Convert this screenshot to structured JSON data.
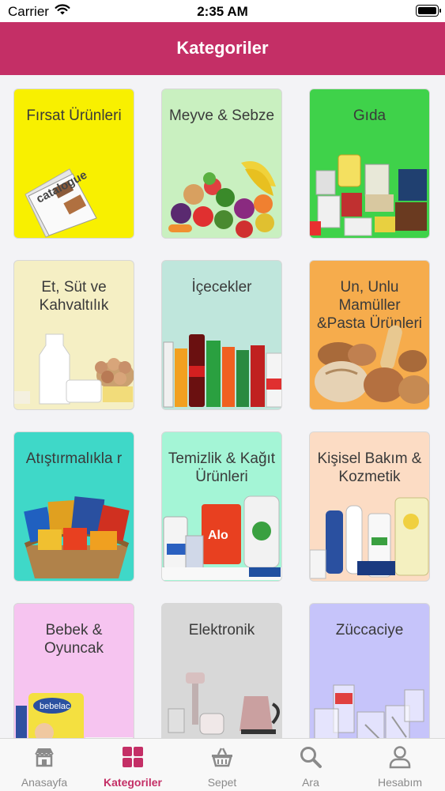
{
  "status": {
    "carrier": "Carrier",
    "time": "2:35 AM"
  },
  "header": {
    "title": "Kategoriler"
  },
  "categories": [
    {
      "label": "Fırsat Ürünleri",
      "bg": "#f8f000",
      "icon": "catalogue-image"
    },
    {
      "label": "Meyve & Sebze",
      "bg": "#c9f0c0",
      "icon": "fruits-vegetables-image"
    },
    {
      "label": "Gıda",
      "bg": "#3fd24a",
      "icon": "grocery-products-image"
    },
    {
      "label": "Et, Süt ve Kahvaltılık",
      "bg": "#f5efc4",
      "icon": "dairy-breakfast-image"
    },
    {
      "label": "İçecekler",
      "bg": "#bfe6dc",
      "icon": "beverages-image"
    },
    {
      "label": "Un, Unlu Mamüller &Pasta Ürünleri",
      "bg": "#f6ac4c",
      "icon": "bakery-image"
    },
    {
      "label": "Atıştırmalıkla r",
      "bg": "#3fd8c8",
      "icon": "snacks-basket-image"
    },
    {
      "label": "Temizlik & Kağıt Ürünleri",
      "bg": "#a4f5d6",
      "icon": "cleaning-products-image"
    },
    {
      "label": "Kişisel Bakım & Kozmetik",
      "bg": "#fcdcc4",
      "icon": "personal-care-image"
    },
    {
      "label": "Bebek & Oyuncak",
      "bg": "#f6c4f0",
      "icon": "baby-products-image"
    },
    {
      "label": "Elektronik",
      "bg": "#d8d8d8",
      "icon": "electronics-image"
    },
    {
      "label": "Züccaciye",
      "bg": "#c6c4fa",
      "icon": "glassware-image"
    }
  ],
  "tabs": [
    {
      "label": "Anasayfa",
      "icon": "store-icon",
      "active": false
    },
    {
      "label": "Kategoriler",
      "icon": "grid-icon",
      "active": true
    },
    {
      "label": "Sepet",
      "icon": "basket-icon",
      "active": false
    },
    {
      "label": "Ara",
      "icon": "search-icon",
      "active": false
    },
    {
      "label": "Hesabım",
      "icon": "user-icon",
      "active": false
    }
  ],
  "colors": {
    "accent": "#c42f66",
    "inactive": "#8a8a8a"
  }
}
